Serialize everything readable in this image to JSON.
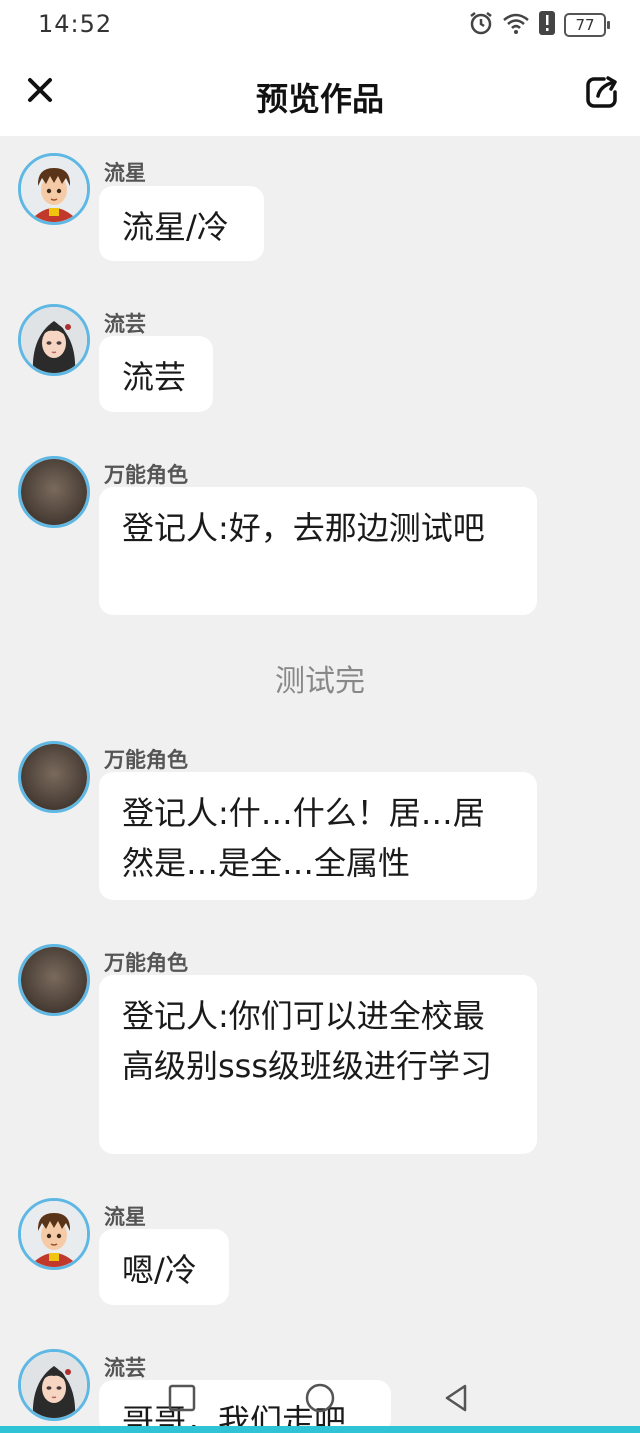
{
  "status_bar": {
    "time": "14:52",
    "battery": "77",
    "icons": [
      "alarm-icon",
      "wifi-icon",
      "alert-icon",
      "battery-icon"
    ]
  },
  "header": {
    "title": "预览作品",
    "close_icon": "close-icon",
    "share_icon": "share-icon"
  },
  "colors": {
    "avatar_border": "#5fb7e3",
    "background": "#f0f0f0",
    "bubble": "#ffffff",
    "accent": "#2ec4d6"
  },
  "messages": [
    {
      "speaker": "流星",
      "text": "流星/冷",
      "avatar": "boy-avatar"
    },
    {
      "speaker": "流芸",
      "text": "流芸",
      "avatar": "girl-avatar"
    },
    {
      "speaker": "万能角色",
      "text": "登记人:好，去那边测试吧",
      "avatar": "generic-avatar"
    },
    {
      "speaker": "万能角色",
      "text": "登记人:什…什么！居…居然是…是全…全属性",
      "avatar": "generic-avatar"
    },
    {
      "speaker": "万能角色",
      "text": "登记人:你们可以进全校最高级别sss级班级进行学习",
      "avatar": "generic-avatar"
    },
    {
      "speaker": "流星",
      "text": "嗯/冷",
      "avatar": "boy-avatar"
    },
    {
      "speaker": "流芸",
      "text": "哥哥，我们走吧",
      "avatar": "girl-avatar"
    }
  ],
  "narration": "测试完",
  "nav": {
    "icons": [
      "recent-apps-icon",
      "home-icon",
      "back-icon"
    ]
  }
}
